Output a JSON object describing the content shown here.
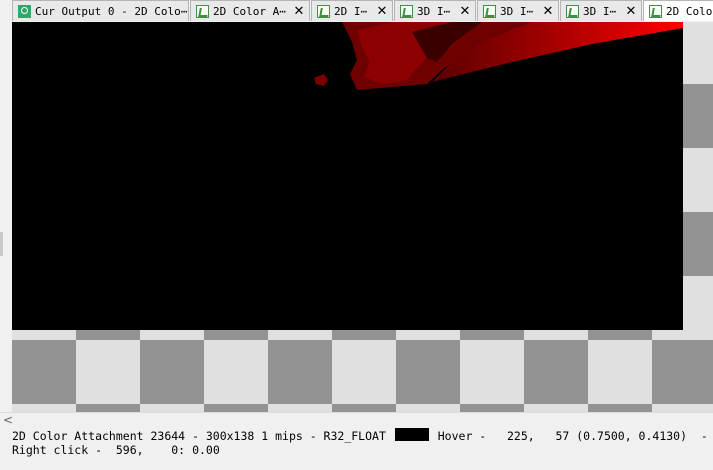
{
  "tabs": [
    {
      "label": "Cur Output 0 - 2D Colo⋯",
      "icon": "output-icon",
      "active": false,
      "closable": false
    },
    {
      "label": "2D Color A⋯",
      "icon": "texture-tab-icon",
      "active": false,
      "closable": true
    },
    {
      "label": "2D I⋯",
      "icon": "texture-tab-icon",
      "active": false,
      "closable": true
    },
    {
      "label": "3D I⋯",
      "icon": "texture-tab-icon",
      "active": false,
      "closable": true
    },
    {
      "label": "3D I⋯",
      "icon": "texture-tab-icon",
      "active": false,
      "closable": true
    },
    {
      "label": "3D I⋯",
      "icon": "texture-tab-icon",
      "active": false,
      "closable": true
    },
    {
      "label": "2D Colo",
      "icon": "texture-tab-icon",
      "active": true,
      "closable": false
    }
  ],
  "close_glyph": "✕",
  "viewer": {
    "checker_colors": [
      "#e0e0e0",
      "#939393"
    ],
    "texture_background": "#000000",
    "render_colors": [
      "#ff0000",
      "#8b0000",
      "#4a0000"
    ]
  },
  "scrollbar": {
    "left_arrow": "<"
  },
  "status": {
    "texture_info": "2D Color Attachment 23644 - 300x138 1 mips - R32_FLOAT",
    "swatch_color": "#000000",
    "hover_label": "Hover -",
    "hover_coords": "225,   57",
    "hover_uv": "(0.7500, 0.4130)",
    "hover_suffix": "-",
    "right_click_label": "Right click -",
    "right_click_coords": "596,    0:",
    "right_click_value": "0.00"
  }
}
